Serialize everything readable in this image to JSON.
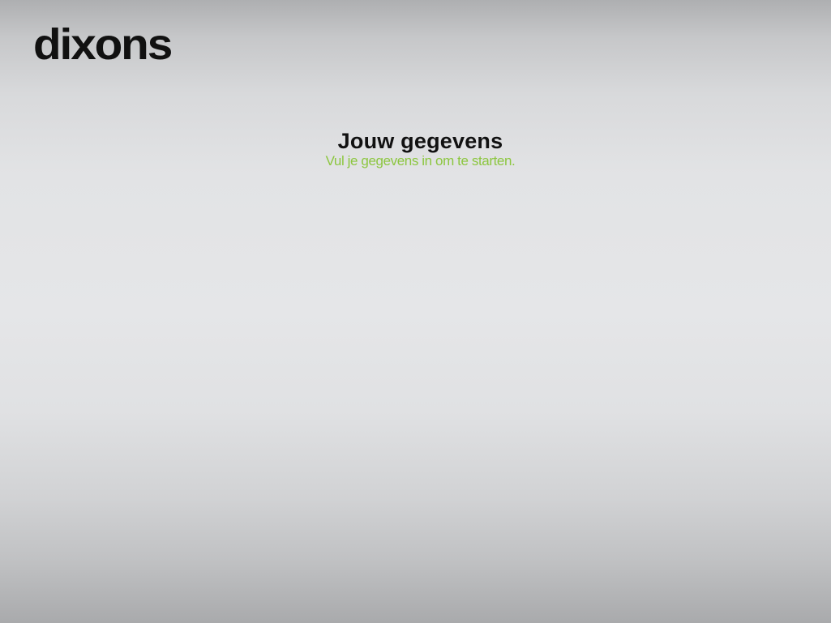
{
  "brand": {
    "logo_text": "dixons"
  },
  "header": {
    "title": "Jouw gegevens",
    "subtitle": "Vul je gegevens in om te starten."
  },
  "colors": {
    "accent_green": "#8cc63f",
    "text_dark": "#111111"
  }
}
